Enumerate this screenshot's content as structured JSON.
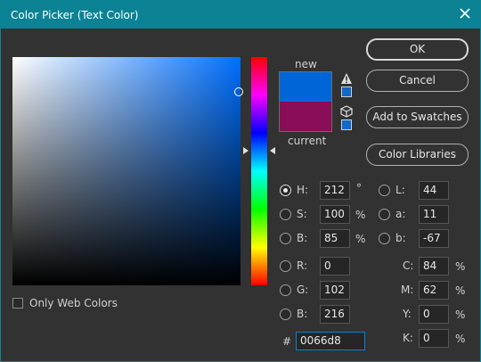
{
  "window": {
    "title": "Color Picker (Text Color)"
  },
  "colors": {
    "titlebar": "#0b8394",
    "new_color": "#0066d8",
    "current_color": "#8a0d57",
    "web_safe_swatch": "#1168c8"
  },
  "icons": {
    "close": "close-icon",
    "gamut_warning": "warning-triangle-icon",
    "web_safe": "cube-icon"
  },
  "swatch": {
    "new_label": "new",
    "current_label": "current"
  },
  "buttons": {
    "ok": "OK",
    "cancel": "Cancel",
    "add_to_swatches": "Add to Swatches",
    "color_libraries": "Color Libraries"
  },
  "hsb": {
    "h": {
      "label": "H:",
      "value": "212",
      "unit": "°",
      "selected": true
    },
    "s": {
      "label": "S:",
      "value": "100",
      "unit": "%"
    },
    "b": {
      "label": "B:",
      "value": "85",
      "unit": "%"
    }
  },
  "rgb": {
    "r": {
      "label": "R:",
      "value": "0"
    },
    "g": {
      "label": "G:",
      "value": "102"
    },
    "b": {
      "label": "B:",
      "value": "216"
    }
  },
  "lab": {
    "l": {
      "label": "L:",
      "value": "44"
    },
    "a": {
      "label": "a:",
      "value": "11"
    },
    "b": {
      "label": "b:",
      "value": "-67"
    }
  },
  "cmyk": {
    "c": {
      "label": "C:",
      "value": "84",
      "unit": "%"
    },
    "m": {
      "label": "M:",
      "value": "62",
      "unit": "%"
    },
    "y": {
      "label": "Y:",
      "value": "0",
      "unit": "%"
    },
    "k": {
      "label": "K:",
      "value": "0",
      "unit": "%"
    }
  },
  "hex": {
    "label": "#",
    "value": "0066d8"
  },
  "options": {
    "only_web_colors": "Only Web Colors"
  }
}
